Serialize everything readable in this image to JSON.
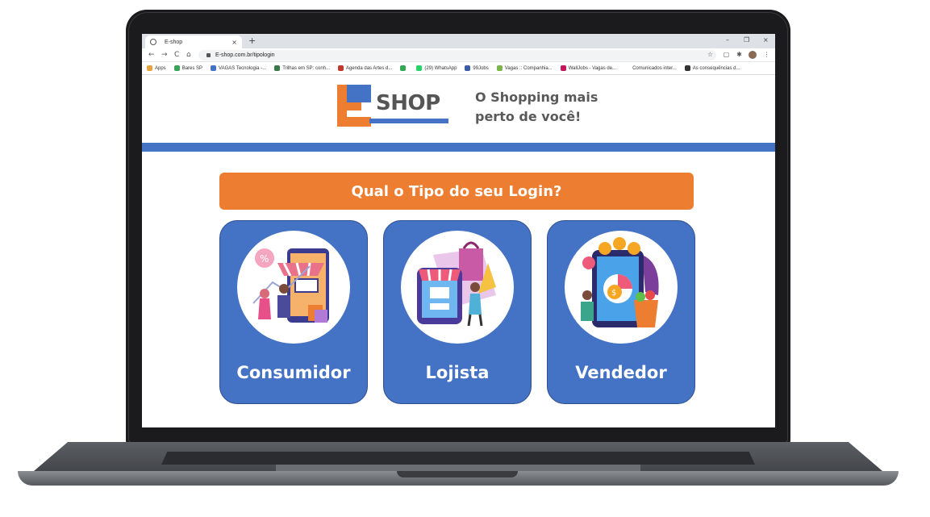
{
  "browser": {
    "tab_title": "E-shop",
    "url": "E-shop.com.br/tipologin",
    "new_tab_label": "+",
    "tab_close_label": "×",
    "nav": {
      "back": "←",
      "forward": "→",
      "reload": "C",
      "home": "⌂"
    },
    "window_controls": {
      "minimize": "–",
      "maximize": "❐",
      "close": "×"
    },
    "bookmarks": [
      {
        "label": "Apps",
        "icon": "apps-grid-icon",
        "color": "#e8a33d"
      },
      {
        "label": "Bares SP",
        "icon": "bookmark-site-icon",
        "color": "#3aa55a"
      },
      {
        "label": "VAGAS Tecnologia -...",
        "icon": "bookmark-site-icon",
        "color": "#4472c4"
      },
      {
        "label": "Trilhas em SP: conh...",
        "icon": "bookmark-site-icon",
        "color": "#3a7a4a"
      },
      {
        "label": "Agenda das Artes d...",
        "icon": "bookmark-site-icon",
        "color": "#c0392b"
      },
      {
        "label": "",
        "icon": "drive-icon",
        "color": "#34a853"
      },
      {
        "label": "(29) WhatsApp",
        "icon": "whatsapp-icon",
        "color": "#25d366"
      },
      {
        "label": "99Jobs",
        "icon": "bookmark-site-icon",
        "color": "#3b5ba5"
      },
      {
        "label": "Vagas :: Companhia...",
        "icon": "bookmark-site-icon",
        "color": "#7ab648"
      },
      {
        "label": "WallJobs - Vagas de...",
        "icon": "bookmark-site-icon",
        "color": "#c2185b"
      },
      {
        "label": "Comunicados inter...",
        "icon": "bookmark-site-icon",
        "color": "#ffffff"
      },
      {
        "label": "As consequências d...",
        "icon": "bookmark-site-icon",
        "color": "#333333"
      }
    ]
  },
  "page": {
    "logo": {
      "letter": "E",
      "text": "SHOP"
    },
    "tagline": "O Shopping mais perto de você!",
    "question": "Qual o Tipo do seu Login?",
    "options": [
      {
        "label": "Consumidor",
        "icon": "shopping-customer-icon"
      },
      {
        "label": "Lojista",
        "icon": "store-owner-icon"
      },
      {
        "label": "Vendedor",
        "icon": "seller-phone-icon"
      }
    ],
    "colors": {
      "primary_blue": "#4472c4",
      "accent_orange": "#ed7d31",
      "text_gray": "#595959"
    }
  }
}
